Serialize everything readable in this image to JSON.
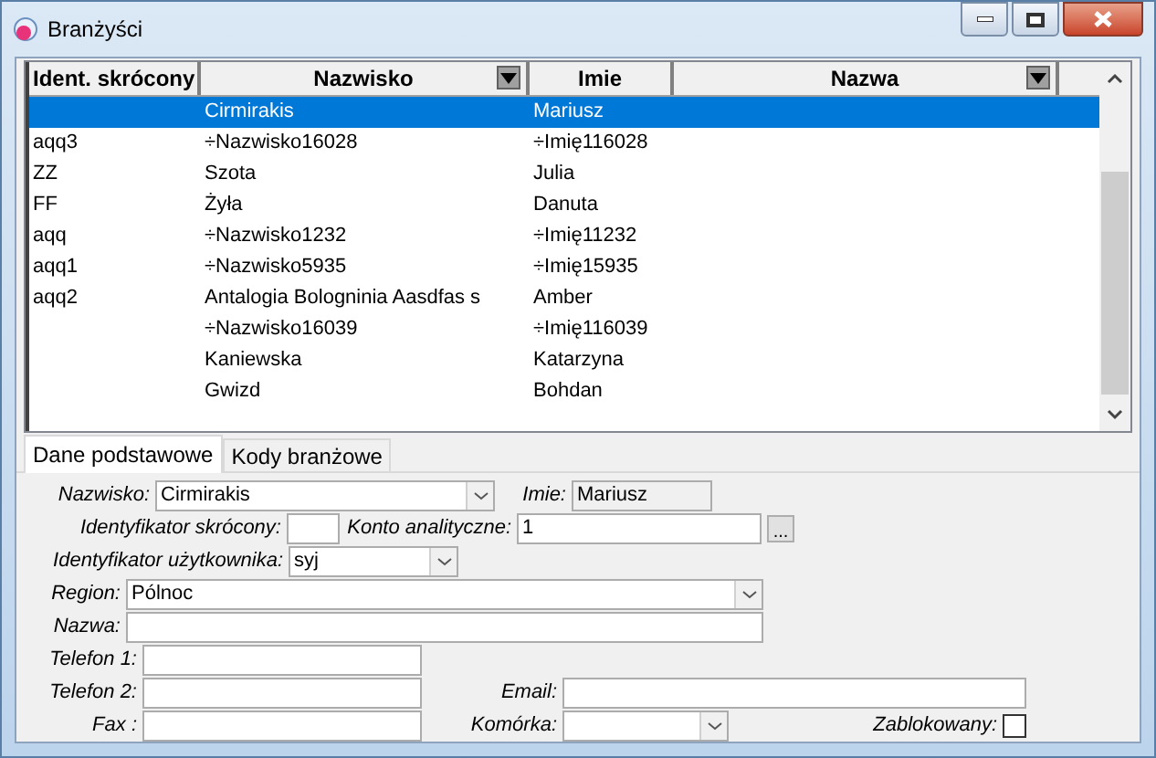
{
  "window": {
    "title": "Branżyści"
  },
  "table": {
    "columns": [
      {
        "label": "Ident. skrócony",
        "filter": false
      },
      {
        "label": "Nazwisko",
        "filter": true
      },
      {
        "label": "Imie",
        "filter": false
      },
      {
        "label": "Nazwa",
        "filter": true
      }
    ],
    "rows": [
      {
        "selected": true,
        "cells": [
          "",
          "Cirmirakis",
          "Mariusz",
          ""
        ]
      },
      {
        "selected": false,
        "cells": [
          "aqq3",
          "÷Nazwisko16028",
          "÷Imię116028",
          ""
        ]
      },
      {
        "selected": false,
        "cells": [
          "ZZ",
          "Szota",
          "Julia",
          ""
        ]
      },
      {
        "selected": false,
        "cells": [
          "FF",
          "Żyła",
          "Danuta",
          ""
        ]
      },
      {
        "selected": false,
        "cells": [
          "aqq",
          "÷Nazwisko1232",
          "÷Imię11232",
          ""
        ]
      },
      {
        "selected": false,
        "cells": [
          "aqq1",
          "÷Nazwisko5935",
          "÷Imię15935",
          ""
        ]
      },
      {
        "selected": false,
        "cells": [
          "aqq2",
          "Antalogia Bologninia Aasdfas s",
          "Amber",
          ""
        ]
      },
      {
        "selected": false,
        "cells": [
          "",
          "÷Nazwisko16039",
          "÷Imię116039",
          ""
        ]
      },
      {
        "selected": false,
        "cells": [
          "",
          "Kaniewska",
          "Katarzyna",
          ""
        ]
      },
      {
        "selected": false,
        "cells": [
          "",
          "Gwizd",
          "Bohdan",
          ""
        ]
      }
    ]
  },
  "tabs": [
    {
      "label": "Dane podstawowe",
      "selected": true
    },
    {
      "label": "Kody branżowe",
      "selected": false
    }
  ],
  "form": {
    "rows": [
      [
        {
          "kind": "combo",
          "label": "Nazwisko:",
          "value": "Cirmirakis"
        },
        {
          "kind": "readonly",
          "label": "Imie:",
          "value": "Mariusz"
        }
      ],
      [
        {
          "kind": "text",
          "label": "Identyfikator skrócony:"
        },
        {
          "kind": "text",
          "label": "Konto analityczne:",
          "value": "1"
        },
        {
          "kind": "button",
          "label": "..."
        }
      ],
      [
        {
          "kind": "combo",
          "label": "Identyfikator użytkownika:",
          "value": "syj"
        }
      ],
      [
        {
          "kind": "combo",
          "label": "Region:",
          "value": "Pólnoc"
        }
      ],
      [
        {
          "kind": "text",
          "label": "Nazwa:"
        }
      ],
      [
        {
          "kind": "text",
          "label": "Telefon 1:"
        }
      ],
      [
        {
          "kind": "text",
          "label": "Telefon 2:"
        },
        {
          "kind": "text",
          "label": "Email:"
        }
      ],
      [
        {
          "kind": "text",
          "label": "Fax :"
        },
        {
          "kind": "combo",
          "label": "Komórka:"
        },
        {
          "kind": "checkbox",
          "label": "Zablokowany:",
          "checked": false
        }
      ]
    ]
  }
}
